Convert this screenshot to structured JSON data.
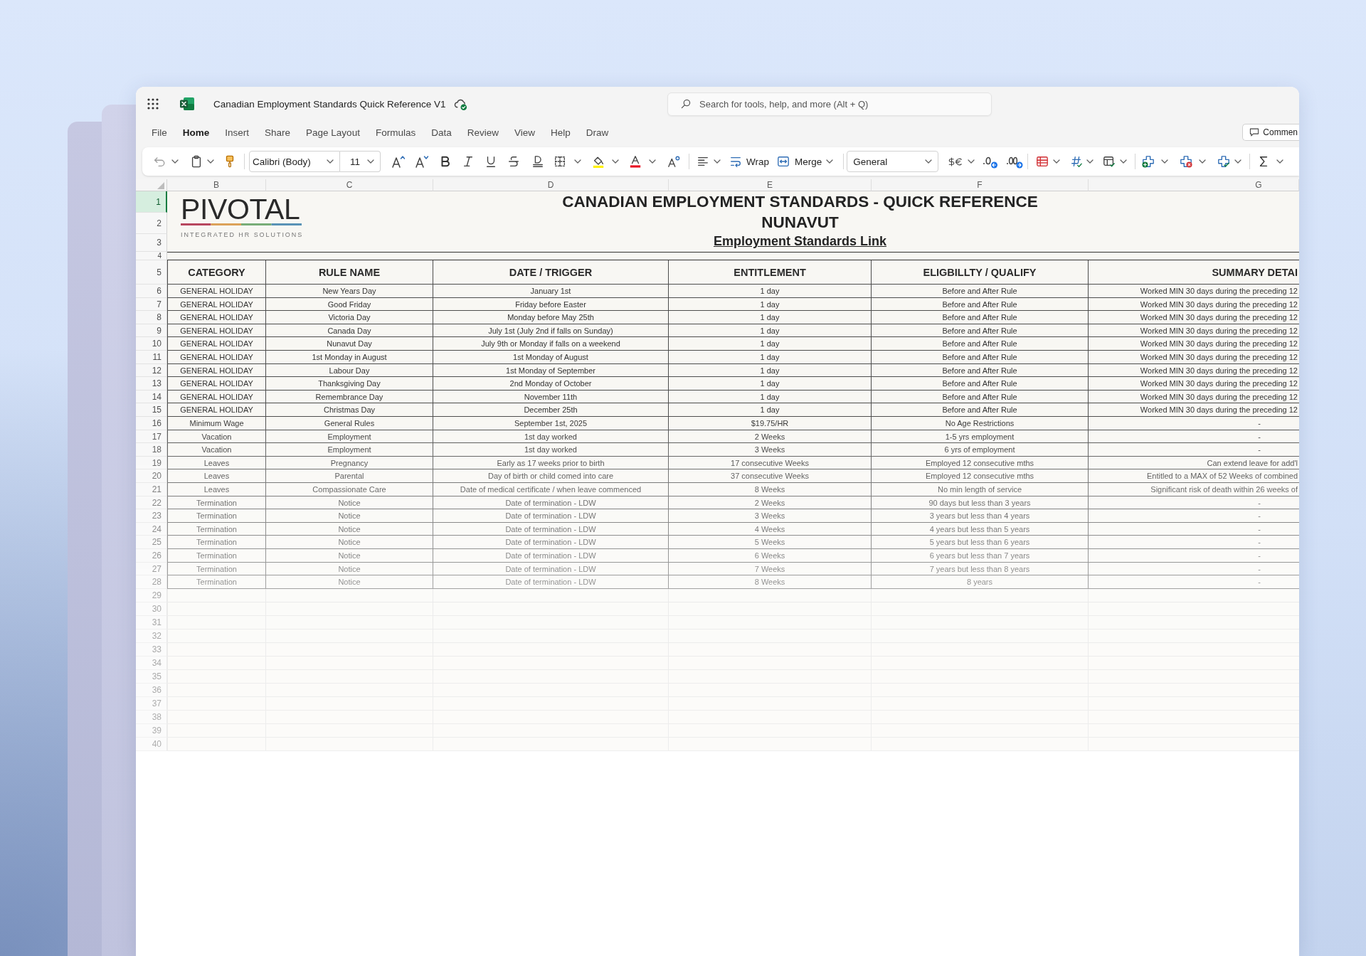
{
  "window": {
    "title": "Canadian Employment Standards Quick Reference V1"
  },
  "search": {
    "placeholder": "Search for tools, help, and more (Alt + Q)"
  },
  "menu": [
    {
      "label": "File",
      "selected": false
    },
    {
      "label": "Home",
      "selected": true
    },
    {
      "label": "Insert",
      "selected": false
    },
    {
      "label": "Share",
      "selected": false
    },
    {
      "label": "Page Layout",
      "selected": false
    },
    {
      "label": "Formulas",
      "selected": false
    },
    {
      "label": "Data",
      "selected": false
    },
    {
      "label": "Review",
      "selected": false
    },
    {
      "label": "View",
      "selected": false
    },
    {
      "label": "Help",
      "selected": false
    },
    {
      "label": "Draw",
      "selected": false
    }
  ],
  "comments_button": {
    "label": "Commen"
  },
  "toolbar": {
    "font_name": "Calibri (Body)",
    "font_size": "11",
    "wrap": "Wrap",
    "merge": "Merge",
    "number_format": "General"
  },
  "sheet": {
    "column_letters": [
      "B",
      "C",
      "D",
      "E",
      "F",
      "G"
    ],
    "row_headers": [
      {
        "label": "1",
        "selected": true
      },
      {
        "label": "2",
        "selected": false
      },
      {
        "label": "3",
        "selected": false
      },
      {
        "label": "4",
        "selected": false
      },
      {
        "label": "5",
        "selected": false
      },
      {
        "label": "6",
        "selected": false
      },
      {
        "label": "7",
        "selected": false
      },
      {
        "label": "8",
        "selected": false
      },
      {
        "label": "9",
        "selected": false
      },
      {
        "label": "10",
        "selected": false
      },
      {
        "label": "11",
        "selected": false
      },
      {
        "label": "12",
        "selected": false
      },
      {
        "label": "13",
        "selected": false
      },
      {
        "label": "14",
        "selected": false
      },
      {
        "label": "15",
        "selected": false
      },
      {
        "label": "16",
        "selected": false
      },
      {
        "label": "17",
        "selected": false
      },
      {
        "label": "18",
        "selected": false
      },
      {
        "label": "19",
        "selected": false
      },
      {
        "label": "20",
        "selected": false
      },
      {
        "label": "21",
        "selected": false
      },
      {
        "label": "22",
        "selected": false
      },
      {
        "label": "23",
        "selected": false
      },
      {
        "label": "24",
        "selected": false
      },
      {
        "label": "25",
        "selected": false
      },
      {
        "label": "26",
        "selected": false
      },
      {
        "label": "27",
        "selected": false
      },
      {
        "label": "28",
        "selected": false
      },
      {
        "label": "29",
        "selected": false
      },
      {
        "label": "30",
        "selected": false
      },
      {
        "label": "31",
        "selected": false
      },
      {
        "label": "32",
        "selected": false
      },
      {
        "label": "33",
        "selected": false
      },
      {
        "label": "34",
        "selected": false
      },
      {
        "label": "35",
        "selected": false
      },
      {
        "label": "36",
        "selected": false
      },
      {
        "label": "37",
        "selected": false
      },
      {
        "label": "38",
        "selected": false
      },
      {
        "label": "39",
        "selected": false
      },
      {
        "label": "40",
        "selected": false
      }
    ],
    "logo": {
      "name": "PIVOTAL",
      "tagline": "INTEGRATED HR SOLUTIONS"
    },
    "title": "CANADIAN EMPLOYMENT STANDARDS - QUICK REFERENCE",
    "subtitle": "NUNAVUT",
    "link": "Employment Standards Link",
    "table": {
      "columns": [
        "CATEGORY",
        "RULE NAME",
        "DATE / TRIGGER",
        "ENTITLEMENT",
        "ELIGBILLTY / QUALIFY",
        "SUMMARY DETAI"
      ],
      "rows": [
        [
          "GENERAL HOLIDAY",
          "New Years Day",
          "January 1st",
          "1 day",
          "Before and After Rule",
          "Worked MIN 30 days during the preceding 12"
        ],
        [
          "GENERAL HOLIDAY",
          "Good Friday",
          "Friday before Easter",
          "1 day",
          "Before and After Rule",
          "Worked MIN 30 days during the preceding 12"
        ],
        [
          "GENERAL HOLIDAY",
          "Victoria Day",
          "Monday before May 25th",
          "1 day",
          "Before and After Rule",
          "Worked MIN 30 days during the preceding 12"
        ],
        [
          "GENERAL HOLIDAY",
          "Canada Day",
          "July 1st (July 2nd if falls on Sunday)",
          "1 day",
          "Before and After Rule",
          "Worked MIN 30 days during the preceding 12"
        ],
        [
          "GENERAL HOLIDAY",
          "Nunavut Day",
          "July 9th or Monday if falls on a weekend",
          "1 day",
          "Before and After Rule",
          "Worked MIN 30 days during the preceding 12"
        ],
        [
          "GENERAL HOLIDAY",
          "1st Monday in August",
          "1st Monday of August",
          "1 day",
          "Before and After Rule",
          "Worked MIN 30 days during the preceding 12"
        ],
        [
          "GENERAL HOLIDAY",
          "Labour Day",
          "1st Monday of September",
          "1 day",
          "Before and After Rule",
          "Worked MIN 30 days during the preceding 12"
        ],
        [
          "GENERAL HOLIDAY",
          "Thanksgiving Day",
          "2nd Monday of October",
          "1 day",
          "Before and After Rule",
          "Worked MIN 30 days during the preceding 12"
        ],
        [
          "GENERAL HOLIDAY",
          "Remembrance Day",
          "November 11th",
          "1 day",
          "Before and After Rule",
          "Worked MIN 30 days during the preceding 12"
        ],
        [
          "GENERAL HOLIDAY",
          "Christmas Day",
          "December 25th",
          "1 day",
          "Before and After Rule",
          "Worked MIN 30 days during the preceding 12"
        ],
        [
          "Minimum Wage",
          "General Rules",
          "September 1st, 2025",
          "$19.75/HR",
          "No Age Restrictions",
          "-"
        ],
        [
          "Vacation",
          "Employment",
          "1st day worked",
          "2 Weeks",
          "1-5 yrs employment",
          "-"
        ],
        [
          "Vacation",
          "Employment",
          "1st day worked",
          "3 Weeks",
          "6 yrs of employment",
          "-"
        ],
        [
          "Leaves",
          "Pregnancy",
          "Early as 17 weeks prior to birth",
          "17 consecutive Weeks",
          "Employed 12 consecutive mths",
          "Can extend leave for add'l"
        ],
        [
          "Leaves",
          "Parental",
          "Day of birth or child comed into care",
          "37 consecutive Weeks",
          "Employed 12 consecutive mths",
          "Entitled to a MAX of 52 Weeks of combined"
        ],
        [
          "Leaves",
          "Compassionate Care",
          "Date of medical certificate / when leave commenced",
          "8 Weeks",
          "No min length of service",
          "Significant risk of death within 26 weeks of"
        ],
        [
          "Termination",
          "Notice",
          "Date of termination - LDW",
          "2 Weeks",
          "90 days but less than 3 years",
          "-"
        ],
        [
          "Termination",
          "Notice",
          "Date of termination - LDW",
          "3 Weeks",
          "3 years but less than 4 years",
          "-"
        ],
        [
          "Termination",
          "Notice",
          "Date of termination - LDW",
          "4 Weeks",
          "4 years but less than 5 years",
          "-"
        ],
        [
          "Termination",
          "Notice",
          "Date of termination - LDW",
          "5 Weeks",
          "5 years but less than 6 years",
          "-"
        ],
        [
          "Termination",
          "Notice",
          "Date of termination - LDW",
          "6 Weeks",
          "6 years but less than 7 years",
          "-"
        ],
        [
          "Termination",
          "Notice",
          "Date of termination - LDW",
          "7 Weeks",
          "7 years but less than 8 years",
          "-"
        ],
        [
          "Termination",
          "Notice",
          "Date of termination - LDW",
          "8 Weeks",
          "8 years",
          "-"
        ]
      ]
    }
  }
}
